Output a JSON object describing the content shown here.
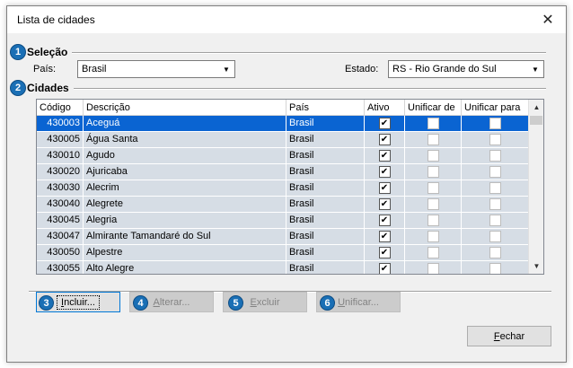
{
  "window": {
    "title": "Lista de cidades"
  },
  "steps": [
    "1",
    "2",
    "3",
    "4",
    "5",
    "6"
  ],
  "selecao": {
    "group_label": "Seleção",
    "pais_label": "País:",
    "pais_value": "Brasil",
    "estado_label": "Estado:",
    "estado_value": "RS - Rio Grande do Sul"
  },
  "cidades": {
    "group_label": "Cidades",
    "columns": [
      "Código",
      "Descrição",
      "País",
      "Ativo",
      "Unificar de",
      "Unificar para"
    ],
    "rows": [
      {
        "codigo": "430003",
        "descricao": "Aceguá",
        "pais": "Brasil",
        "ativo": true,
        "selected": true
      },
      {
        "codigo": "430005",
        "descricao": "Água Santa",
        "pais": "Brasil",
        "ativo": true
      },
      {
        "codigo": "430010",
        "descricao": "Agudo",
        "pais": "Brasil",
        "ativo": true
      },
      {
        "codigo": "430020",
        "descricao": "Ajuricaba",
        "pais": "Brasil",
        "ativo": true
      },
      {
        "codigo": "430030",
        "descricao": "Alecrim",
        "pais": "Brasil",
        "ativo": true
      },
      {
        "codigo": "430040",
        "descricao": "Alegrete",
        "pais": "Brasil",
        "ativo": true
      },
      {
        "codigo": "430045",
        "descricao": "Alegria",
        "pais": "Brasil",
        "ativo": true
      },
      {
        "codigo": "430047",
        "descricao": "Almirante Tamandaré do Sul",
        "pais": "Brasil",
        "ativo": true
      },
      {
        "codigo": "430050",
        "descricao": "Alpestre",
        "pais": "Brasil",
        "ativo": true
      },
      {
        "codigo": "430055",
        "descricao": "Alto Alegre",
        "pais": "Brasil",
        "ativo": true
      }
    ]
  },
  "buttons": {
    "incluir_u": "I",
    "incluir_rest": "ncluir...",
    "alterar_u": "A",
    "alterar_rest": "lterar...",
    "excluir_u": "E",
    "excluir_rest": "xcluir",
    "unificar_u": "U",
    "unificar_rest": "nificar...",
    "fechar_u": "F",
    "fechar_rest": "echar"
  },
  "icons": {
    "close": "close-icon",
    "dropdown": "chevron-down-icon",
    "check": "checkmark-icon"
  },
  "colors": {
    "step_badge": "#1a6fb5",
    "row_selected": "#0a64d2",
    "row_bg": "#d6dde5"
  }
}
